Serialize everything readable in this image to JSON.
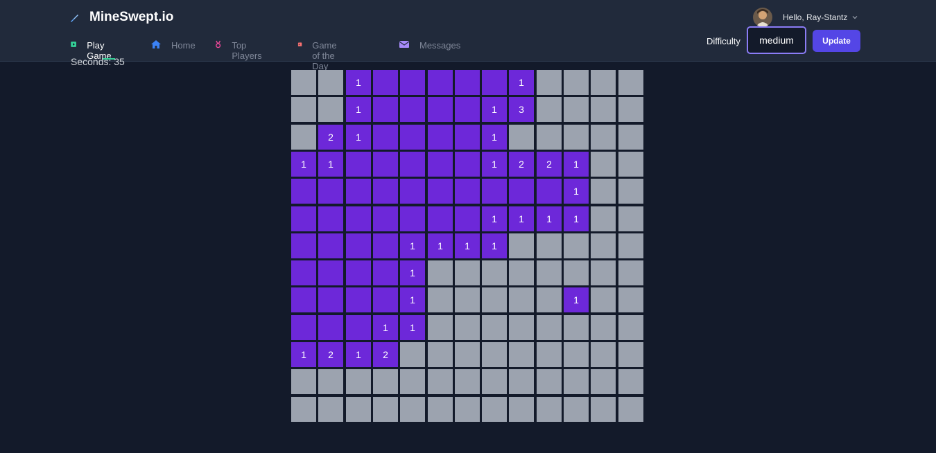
{
  "header": {
    "logo_text": "MineSwept.io",
    "logo_icon": "shovel-icon",
    "user_greeting": "Hello, Ray-Stantz",
    "difficulty_label": "Difficulty",
    "difficulty_value": "medium",
    "update_label": "Update"
  },
  "nav": [
    {
      "label": "Play Game",
      "icon": "play-icon",
      "color": "#34d399",
      "active": true
    },
    {
      "label": "Home",
      "icon": "home-icon",
      "color": "#3b82f6",
      "active": false
    },
    {
      "label": "Top Players",
      "icon": "medal-icon",
      "color": "#ec4899",
      "active": false
    },
    {
      "label": "Game of the Day",
      "icon": "calendar-icon",
      "color": "#f87171",
      "active": false
    },
    {
      "label": "Messages",
      "icon": "envelope-icon",
      "color": "#a78bfa",
      "active": false
    }
  ],
  "game": {
    "seconds_text": "Seconds: 35",
    "rows": 13,
    "cols": 13,
    "board": [
      "HH1OOOOO1HHHH",
      "HH1OOOO13HHHH",
      "H21OOOO1HHHHH",
      "11OOOOO1221HH",
      "OOOOOOOOOO1HH",
      "OOOOOOO1111HH",
      "OOOO1111HHHHH",
      "OOOO1HHHHHHHH",
      "OOOO1HHHHH1HH",
      "OOO11HHHHHHHH",
      "1212HHHHHHHHH",
      "HHHHHHHHHHHHH",
      "HHHHHHHHHHHHH"
    ]
  },
  "colors": {
    "hidden_cell": "#9ca3af",
    "revealed_cell": "#6d28d9",
    "accent": "#5446e6",
    "active_tab_underline": "#34d399"
  }
}
